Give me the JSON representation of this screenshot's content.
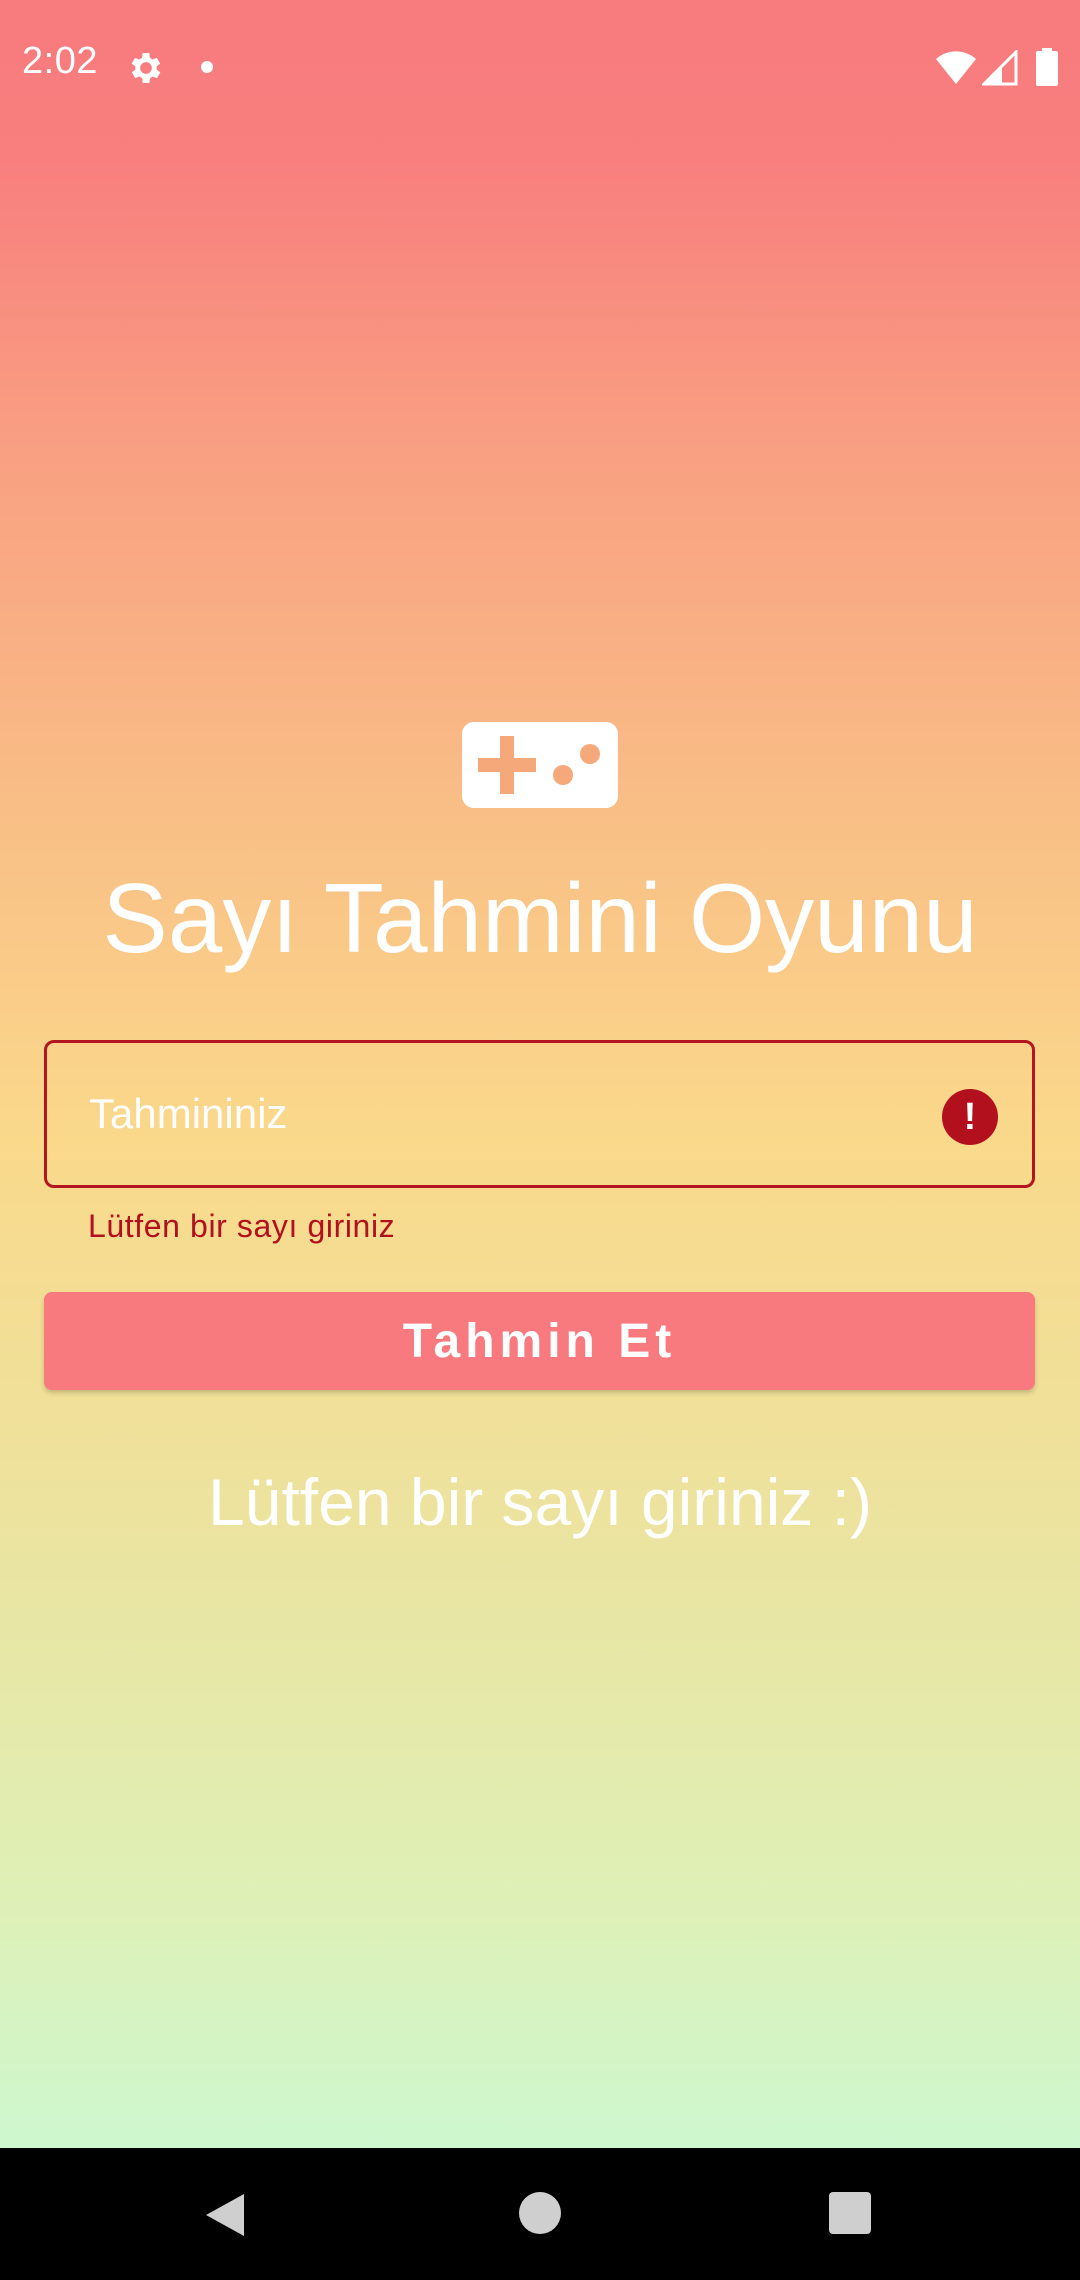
{
  "status_bar": {
    "time": "2:02",
    "icons": [
      "gear-icon",
      "notification-dot-icon",
      "wifi-icon",
      "signal-icon",
      "battery-icon"
    ]
  },
  "app": {
    "icon": "gamepad-icon",
    "title": "Sayı Tahmini Oyunu"
  },
  "guess_field": {
    "placeholder": "Tahmininiz",
    "value": "",
    "error_icon": "!",
    "error_message": "Lütfen bir sayı giriniz"
  },
  "guess_button": {
    "label": "Tahmin Et"
  },
  "result": {
    "message": "Lütfen bir sayı giriniz :)"
  },
  "nav_bar": {
    "icons": [
      "back-icon",
      "home-icon",
      "recents-icon"
    ]
  },
  "colors": {
    "gradient_top": "#f87b7e",
    "gradient_middle": "#fad98b",
    "gradient_bottom": "#c4fbdc",
    "error": "#b3101e",
    "button": "#f87a7e",
    "icon_accent": "#f5a97a"
  }
}
